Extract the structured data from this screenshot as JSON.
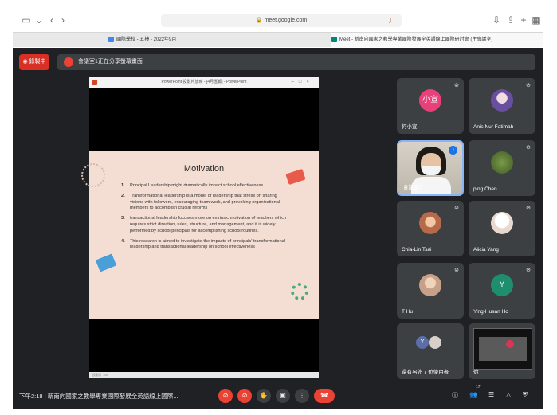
{
  "browser": {
    "url": "meet.google.com",
    "tabs": [
      {
        "label": "國際學校 - 五樓 - 2022年9月",
        "active": false
      },
      {
        "label": "Meet - 新南向國家之教學專業國際發展全英語線上國際研討會 (主會議室)",
        "active": true
      }
    ]
  },
  "meet": {
    "record_label": "錄製中",
    "presenting_text": "會議室1正在分享螢幕畫面",
    "meeting_time": "下午2:18",
    "meeting_title": "新南向國家之教學專業國際發展全英語線上國際...",
    "more_count": "17"
  },
  "presentation": {
    "window_title": "PowerPoint 投影片放映 - [4月匯報] - PowerPoint",
    "status": "投影片 1/6",
    "slide_title": "Motivation",
    "points": [
      {
        "num": "1.",
        "text": "Principal Leadership might dramatically impact school effectiveness"
      },
      {
        "num": "2.",
        "text": "Transformational leadership is a model of leadership that stress on sharing visions with followers, encouraging team work, and provoking organizational members to accomplish crucial reforms"
      },
      {
        "num": "3.",
        "text": "transactional leadership focuses more on extrinsic motivation of teachers which requires strict direction, rules, structure, and management, and it is widely performed by school principals for accomplishing school routines."
      },
      {
        "num": "4.",
        "text": "This research is aimed to investigate the impacts of principals' transformational leadership and transactional leadership on school effectiveness"
      }
    ]
  },
  "participants": [
    {
      "name": "何小宣",
      "avatar_text": "小宣",
      "avatar_color": "#e8417a"
    },
    {
      "name": "Anis Nur Fatimah",
      "avatar_text": "",
      "avatar_color": "#6a4fa0"
    },
    {
      "name": "會議室1",
      "avatar_text": "",
      "avatar_color": "#cccccc"
    },
    {
      "name": "ping Chen",
      "avatar_text": "",
      "avatar_color": "#6b7f3a"
    },
    {
      "name": "Chia-Lin Tsai",
      "avatar_text": "",
      "avatar_color": "#b76a4a"
    },
    {
      "name": "Alicia Yang",
      "avatar_text": "",
      "avatar_color": "#e8d8d0"
    },
    {
      "name": "T Hu",
      "avatar_text": "",
      "avatar_color": "#c7a08a"
    },
    {
      "name": "Ying-Husan Ho",
      "avatar_text": "Y",
      "avatar_color": "#1e8e6e"
    },
    {
      "name": "還有另外 7 位使用者",
      "avatar_text": "Y",
      "avatar_color": "#5b6ea8"
    },
    {
      "name": "你",
      "avatar_text": "",
      "avatar_color": "#111111"
    }
  ]
}
